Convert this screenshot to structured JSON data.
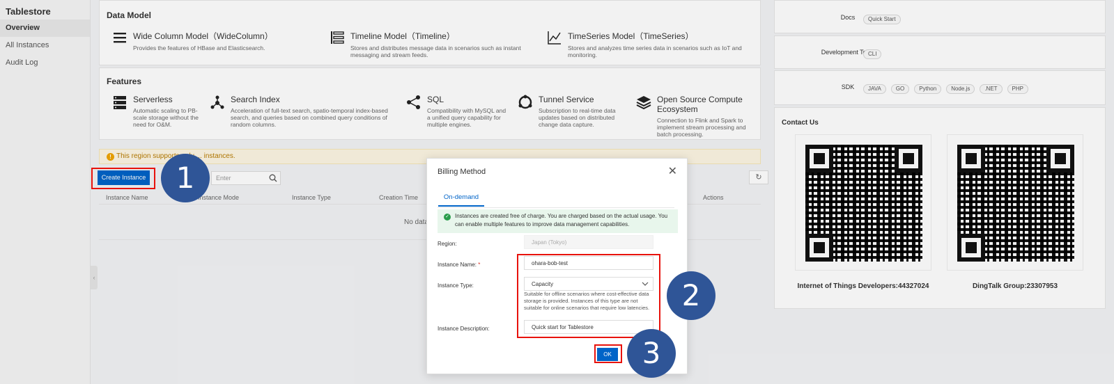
{
  "sidebar": {
    "title": "Tablestore",
    "items": [
      {
        "label": "Overview"
      },
      {
        "label": "All Instances"
      },
      {
        "label": "Audit Log"
      }
    ]
  },
  "data_model": {
    "title": "Data Model",
    "items": [
      {
        "name": "Wide Column Model（WideColumn）",
        "desc": "Provides the features of HBase and Elasticsearch.",
        "icon": "list-icon"
      },
      {
        "name": "Timeline Model（Timeline）",
        "desc": "Stores and distributes message data in scenarios such as instant messaging and stream feeds.",
        "icon": "timeline-icon"
      },
      {
        "name": "TimeSeries Model（TimeSeries）",
        "desc": "Stores and analyzes time series data in scenarios such as IoT and monitoring.",
        "icon": "line-chart-icon"
      }
    ]
  },
  "features": {
    "title": "Features",
    "items": [
      {
        "name": "Serverless",
        "desc": "Automatic scaling to PB-scale storage without the need for O&M.",
        "icon": "server-icon"
      },
      {
        "name": "Search Index",
        "desc": "Acceleration of full-text search, spatio-temporal index-based search, and queries based on combined query conditions of random columns.",
        "icon": "search-index-icon"
      },
      {
        "name": "SQL",
        "desc": "Compatibility with MySQL and a unified query capability for multiple engines.",
        "icon": "share-nodes-icon"
      },
      {
        "name": "Tunnel Service",
        "desc": "Subscription to real-time data updates based on distributed change data capture.",
        "icon": "tunnel-icon"
      },
      {
        "name": "Open Source Compute Ecosystem",
        "desc": "Connection to Flink and Spark to implement stream processing and batch processing.",
        "icon": "layers-icon"
      }
    ]
  },
  "alert": {
    "text": "This region supports only ... instances."
  },
  "toolbar": {
    "create_label": "Create Instance",
    "search_placeholder": "Enter",
    "refresh_icon": "refresh-icon"
  },
  "table": {
    "headers": [
      "Instance Name",
      "Instance Mode",
      "Instance Type",
      "Creation Time",
      "Actions"
    ],
    "empty": "No data"
  },
  "right": {
    "docs_label": "Docs",
    "docs_tags": [
      "Quick Start"
    ],
    "devtools_label": "Development Tools",
    "devtools_tags": [
      "CLI"
    ],
    "sdk_label": "SDK",
    "sdk_tags": [
      "JAVA",
      "GO",
      "Python",
      "Node.js",
      ".NET",
      "PHP"
    ],
    "contact_title": "Contact Us",
    "qr1_caption": "Internet of Things Developers:44327024",
    "qr2_caption": "DingTalk Group:23307953"
  },
  "dialog": {
    "title": "Billing Method",
    "tab": "On-demand",
    "info": "Instances are created free of charge. You are charged based on the actual usage. You can enable multiple features to improve data management capabilities.",
    "region_label": "Region:",
    "region_value": "Japan (Tokyo)",
    "name_label": "Instance Name:",
    "name_value": "ohara-bob-test",
    "type_label": "Instance Type:",
    "type_value": "Capacity",
    "type_help": "Suitable for offline scenarios where cost-effective data storage is provided. Instances of this type are not suitable for online scenarios that require low latencies.",
    "desc_label": "Instance Description:",
    "desc_value": "Quick start for Tablestore",
    "ok_label": "OK"
  },
  "steps": [
    "1",
    "2",
    "3"
  ],
  "colors": {
    "accent": "#0064c8",
    "highlight": "#e8120c",
    "step": "#2f5597"
  }
}
